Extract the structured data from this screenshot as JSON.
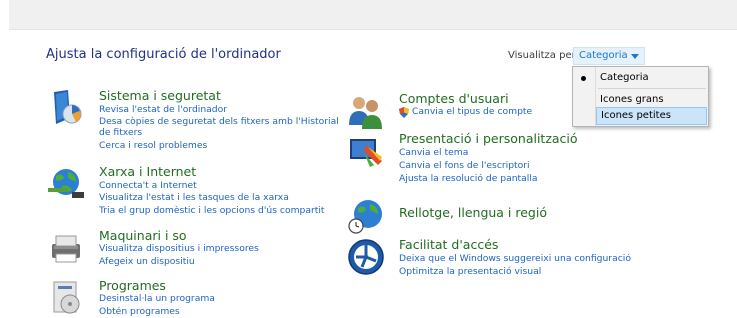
{
  "page": {
    "title": "Ajusta la configuració de l'ordinador",
    "view_by_label": "Visualitza per:",
    "view_by_selected": "Categoria"
  },
  "view_menu": {
    "items": [
      {
        "label": "Categoria",
        "checked": true
      },
      {
        "label": "Icones grans",
        "checked": false
      },
      {
        "label": "Icones petites",
        "checked": false,
        "highlighted": true
      }
    ]
  },
  "categories_left": [
    {
      "title": "Sistema i seguretat",
      "icon": "security-shield-icon",
      "links": [
        "Revisa l'estat de l'ordinador",
        "Desa còpies de seguretat dels fitxers amb l'Historial",
        "de fitxers",
        "Cerca i resol problemes"
      ]
    },
    {
      "title": "Xarxa i Internet",
      "icon": "network-globe-icon",
      "links": [
        "Connecta't a Internet",
        "Visualitza l'estat i les tasques de la xarxa",
        "Tria el grup domèstic i les opcions d'ús compartit"
      ]
    },
    {
      "title": "Maquinari i so",
      "icon": "printer-icon",
      "links": [
        "Visualitza dispositius i impressores",
        "Afegeix un dispositiu"
      ]
    },
    {
      "title": "Programes",
      "icon": "programs-icon",
      "links": [
        "Desinstal·la un programa",
        "Obtén programes"
      ]
    }
  ],
  "categories_right": [
    {
      "title": "Comptes d'usuari",
      "icon": "user-accounts-icon",
      "links": [
        "Canvia el tipus de compte"
      ]
    },
    {
      "title": "Presentació i personalització",
      "icon": "personalization-icon",
      "links": [
        "Canvia el tema",
        "Canvia el fons de l'escriptori",
        "Ajusta la resolució de pantalla"
      ]
    },
    {
      "title": "Rellotge, llengua i regió",
      "icon": "clock-globe-icon",
      "links": []
    },
    {
      "title": "Facilitat d'accés",
      "icon": "ease-of-access-icon",
      "links": [
        "Deixa que el Windows suggereixi una configuració",
        "Optimitza la presentació visual"
      ]
    }
  ]
}
